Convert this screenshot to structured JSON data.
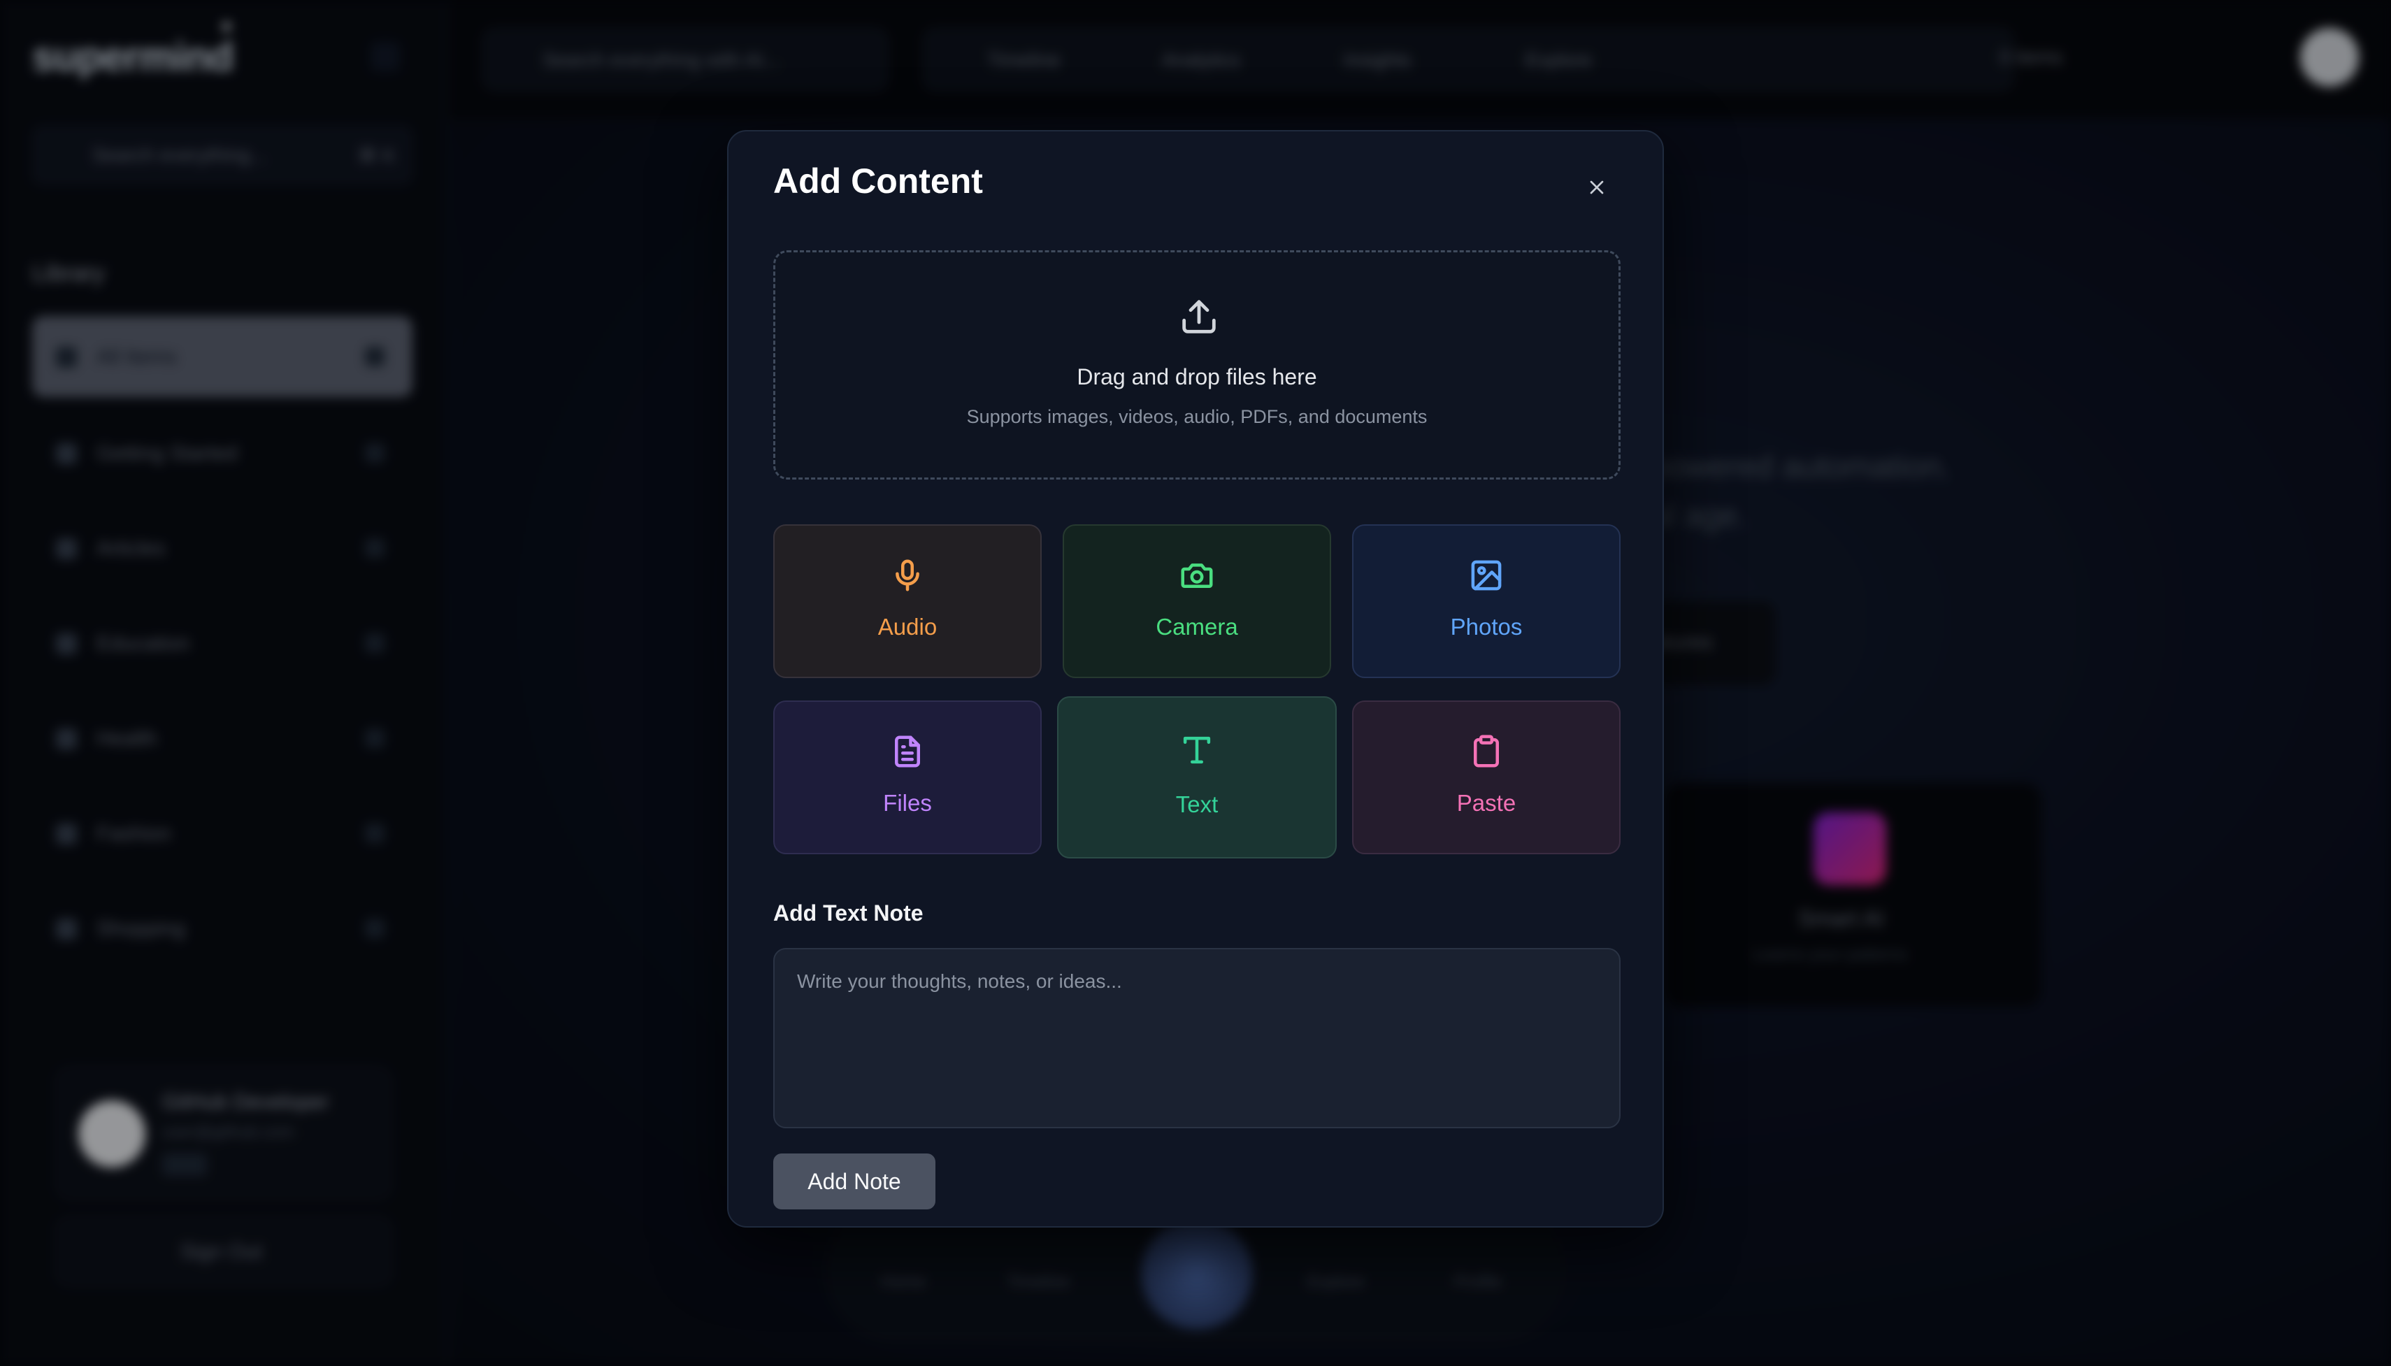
{
  "app": {
    "logo": "supermind",
    "sidebar_search": "Search everything...",
    "sidebar_search_kbd": "⌘ K",
    "library_heading": "Library",
    "items": [
      {
        "label": "All Items"
      },
      {
        "label": "Getting Started"
      },
      {
        "label": "Articles"
      },
      {
        "label": "Education"
      },
      {
        "label": "Health"
      },
      {
        "label": "Fashion"
      },
      {
        "label": "Shopping"
      }
    ],
    "user_name": "GitHub Developer",
    "user_email": "user@github.com",
    "sign_out": "Sign Out",
    "top_search": "Search everything with AI...",
    "top_search_kbd": "⌘ K",
    "nav": [
      "Timeline",
      "Analytics",
      "Insights",
      "Explore"
    ],
    "item_count": "0 items",
    "hero_line1": "powered automation.",
    "hero_line2": "al age.",
    "hero_button": "atures",
    "card_title": "Smart AI",
    "card_sub": "Learns your patterns",
    "bottom_nav": [
      "Home",
      "Timeline",
      "Explore",
      "Profile"
    ]
  },
  "modal": {
    "title": "Add Content",
    "dropzone": {
      "title": "Drag and drop files here",
      "subtitle": "Supports images, videos, audio, PDFs, and documents"
    },
    "tiles": {
      "audio": {
        "label": "Audio",
        "icon": "microphone-icon",
        "color": "#f59e4b"
      },
      "camera": {
        "label": "Camera",
        "icon": "camera-icon",
        "color": "#4ade80"
      },
      "photos": {
        "label": "Photos",
        "icon": "image-icon",
        "color": "#60a5fa"
      },
      "files": {
        "label": "Files",
        "icon": "file-text-icon",
        "color": "#c084fc"
      },
      "text": {
        "label": "Text",
        "icon": "type-icon",
        "color": "#34d399"
      },
      "paste": {
        "label": "Paste",
        "icon": "clipboard-icon",
        "color": "#f472b6"
      }
    },
    "note_label": "Add Text Note",
    "note_placeholder": "Write your thoughts, notes, or ideas...",
    "note_value": "",
    "add_button": "Add Note"
  }
}
